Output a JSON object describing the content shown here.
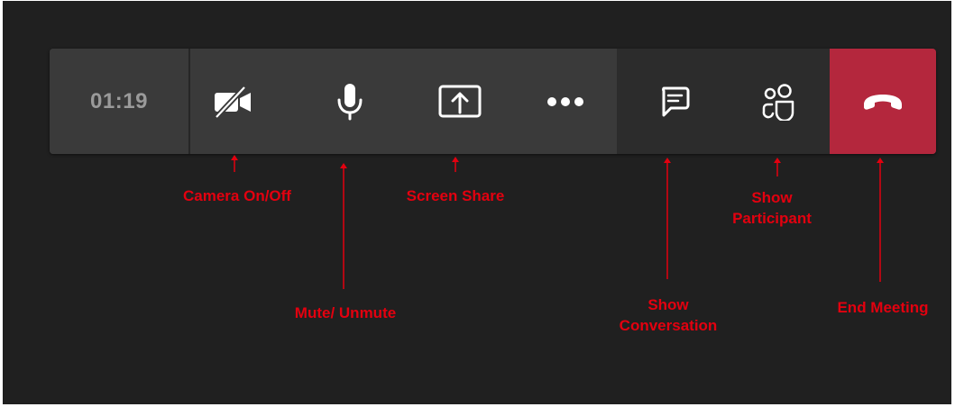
{
  "toolbar": {
    "timer": "01:19",
    "buttons": [
      {
        "id": "camera",
        "icon": "camera-off-icon"
      },
      {
        "id": "mic",
        "icon": "microphone-icon"
      },
      {
        "id": "share",
        "icon": "share-screen-icon"
      },
      {
        "id": "more",
        "icon": "more-options-icon"
      },
      {
        "id": "chat",
        "icon": "chat-icon"
      },
      {
        "id": "participants",
        "icon": "participants-icon"
      },
      {
        "id": "hangup",
        "icon": "hang-up-icon"
      }
    ]
  },
  "annotations": {
    "camera": "Camera On/Off",
    "mute": "Mute/ Unmute",
    "screen_share": "Screen Share",
    "show_conversation_line1": "Show",
    "show_conversation_line2": "Conversation",
    "show_participant_line1": "Show",
    "show_participant_line2": "Participant",
    "end_meeting": "End Meeting"
  },
  "colors": {
    "background": "#202020",
    "toolbar": "#3a3a3a",
    "toolbar_dark": "#2c2c2c",
    "hangup": "#b4273d",
    "annotation": "#e3000f",
    "icon": "#ffffff",
    "timer_text": "#9a9a9a"
  }
}
